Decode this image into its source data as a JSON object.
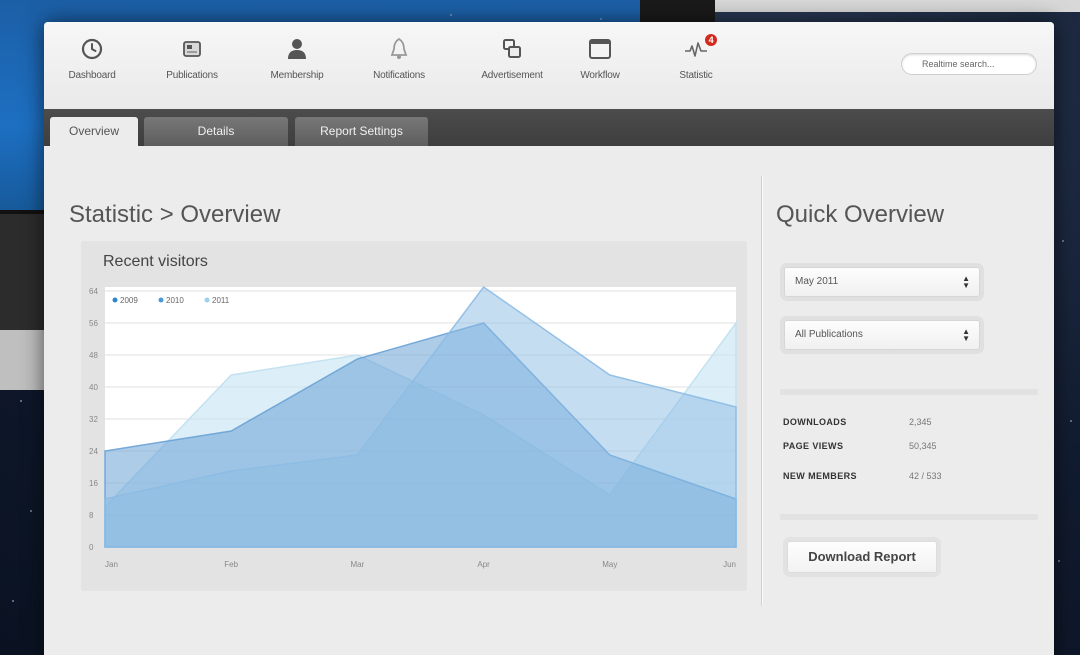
{
  "nav": {
    "items": [
      {
        "label": "Dashboard",
        "icon": "clock-icon"
      },
      {
        "label": "Publications",
        "icon": "publication-icon"
      },
      {
        "label": "Membership",
        "icon": "user-icon"
      },
      {
        "label": "Notifications",
        "icon": "bell-icon"
      },
      {
        "label": "Advertisement",
        "icon": "windows-icon"
      },
      {
        "label": "Workflow",
        "icon": "window-icon"
      },
      {
        "label": "Statistic",
        "icon": "pulse-icon",
        "badge": "4"
      }
    ]
  },
  "search": {
    "placeholder": "Realtime search..."
  },
  "tabs": [
    "Overview",
    "Details",
    "Report Settings"
  ],
  "main": {
    "breadcrumb": "Statistic > Overview"
  },
  "chart_panel": {
    "title": "Recent visitors"
  },
  "chart_data": {
    "type": "area",
    "title": "Recent visitors",
    "categories": [
      "Jan",
      "Feb",
      "Mar",
      "Apr",
      "May",
      "Jun"
    ],
    "yticks": [
      0,
      8,
      16,
      24,
      32,
      40,
      48,
      56,
      64
    ],
    "ylim": [
      0,
      64
    ],
    "legend_position": "top-left",
    "grid": true,
    "series": [
      {
        "name": "2009",
        "values": [
          24,
          29,
          47,
          56,
          23,
          12
        ],
        "color": "#6aa3d6"
      },
      {
        "name": "2010",
        "values": [
          12,
          19,
          23,
          65,
          43,
          35
        ],
        "color": "#8cbbe4"
      },
      {
        "name": "2011",
        "values": [
          10,
          43,
          48,
          33,
          13,
          56
        ],
        "color": "#bfe0f1"
      }
    ]
  },
  "sidebar": {
    "title": "Quick Overview",
    "month_select": "May 2011",
    "publication_select": "All Publications",
    "stats": [
      {
        "label": "DOWNLOADS",
        "value": "2,345"
      },
      {
        "label": "PAGE VIEWS",
        "value": "50,345"
      },
      {
        "label": "NEW MEMBERS",
        "value": "42 / 533"
      }
    ],
    "download_button": "Download Report"
  }
}
